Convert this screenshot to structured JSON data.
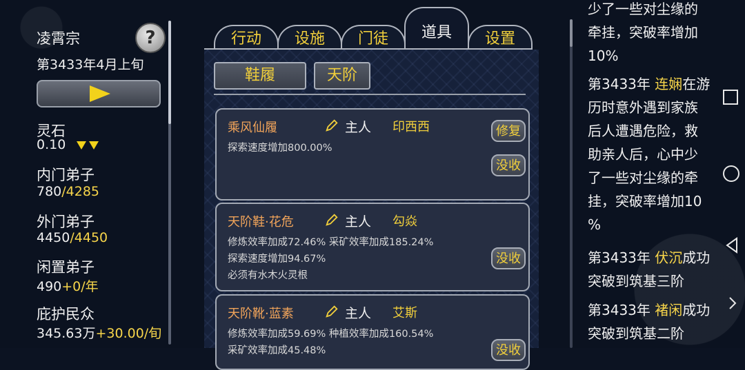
{
  "sect": {
    "name": "凌霄宗",
    "date": "第3433年4月上旬"
  },
  "stats": {
    "spirit_stone": {
      "label": "灵石",
      "value": "0.10"
    },
    "inner": {
      "label": "内门弟子",
      "current": "780",
      "sep": "/",
      "max": "4285"
    },
    "outer": {
      "label": "外门弟子",
      "current": "4450",
      "sep": "/",
      "max": "4450"
    },
    "idle": {
      "label": "闲置弟子",
      "current": "490",
      "delta": "+0/年"
    },
    "people": {
      "label": "庇护民众",
      "current": "345.63万",
      "delta": "+30.00/旬"
    }
  },
  "tabs": [
    "行动",
    "设施",
    "门徒",
    "道具",
    "设置"
  ],
  "active_tab": "道具",
  "subtabs": [
    "鞋履",
    "天阶"
  ],
  "items": [
    {
      "name": "乘风仙履",
      "owner_label": "主人",
      "owner": "印西西",
      "lines": [
        "探索速度增加800.00%"
      ],
      "buttons": [
        "修复",
        "没收"
      ]
    },
    {
      "name": "天阶鞋·花危",
      "owner_label": "主人",
      "owner": "勾焱",
      "lines": [
        "修炼效率加成72.46% 采矿效率加成185.24%",
        "探索速度增加94.67%",
        "必须有水木火灵根"
      ],
      "buttons": [
        "没收"
      ]
    },
    {
      "name": "天阶靴·蓝素",
      "owner_label": "主人",
      "owner": "艾斯",
      "lines": [
        "修炼效率加成59.69% 种植效率加成160.54%",
        "采矿效率加成45.48%"
      ],
      "buttons": [
        "没收"
      ]
    }
  ],
  "log": {
    "entry0": {
      "line1": "少了一些对尘缘的",
      "line2": "牵挂，突破率增加",
      "line3": "10%"
    },
    "entry1": {
      "year": "第3433年",
      "who": "连娴",
      "rest1": "在游",
      "line2": "历时意外遇到家族",
      "line3": "后人遭遇危险，救",
      "line4": "助亲人后，心中少",
      "line5": "了一些对尘缘的牵",
      "line6": "挂，突破率增加10",
      "line7": "%"
    },
    "entry2": {
      "year": "第3433年",
      "who": "伏沉",
      "rest1": "成功",
      "line2": "突破到筑基三阶"
    },
    "entry3": {
      "year": "第3433年",
      "who": "褚闲",
      "rest1": "成功",
      "line2": "突破到筑基二阶"
    }
  },
  "icons": [
    "help-icon",
    "play-icon",
    "down-arrows-icon",
    "pencil-icon",
    "square-icon",
    "circle-icon",
    "back-icon",
    "chevron-right-icon"
  ]
}
